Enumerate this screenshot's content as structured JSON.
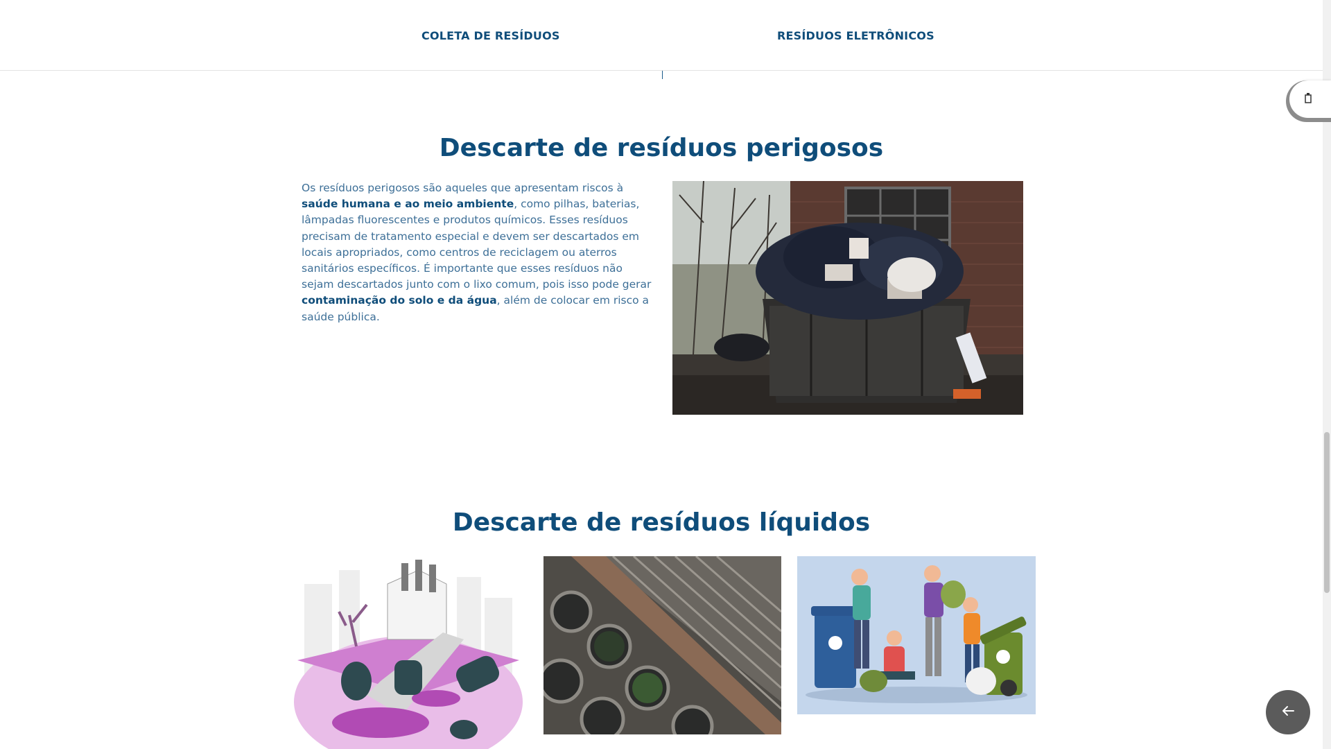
{
  "nav": {
    "link1": "COLETA DE RESÍDUOS",
    "link2": "RESÍDUOS ELETRÔNICOS"
  },
  "section1": {
    "title": "Descarte de resíduos perigosos",
    "p_1": "Os resíduos perigosos são aqueles que apresentam riscos à ",
    "p_bold_1": "saúde humana e ao meio ambiente",
    "p_2": ", como pilhas, baterias, lâmpadas fluorescentes e produtos químicos. Esses resíduos precisam de tratamento especial e devem ser descartados em locais apropriados, como centros de reciclagem ou aterros sanitários específicos. É importante que esses resíduos não sejam descartados junto com o lixo comum, pois isso pode gerar ",
    "p_bold_2": "contaminação do solo e da água",
    "p_3": ", além de colocar em risco a saúde pública."
  },
  "section2": {
    "title": "Descarte de resíduos líquidos"
  },
  "widgets": {
    "a11y_icon": "accessibility-icon",
    "back_icon": "arrow-left-icon"
  },
  "colors": {
    "heading": "#0f4d7a",
    "body_text": "#3d6f97",
    "bold_text": "#0f4d7a"
  }
}
